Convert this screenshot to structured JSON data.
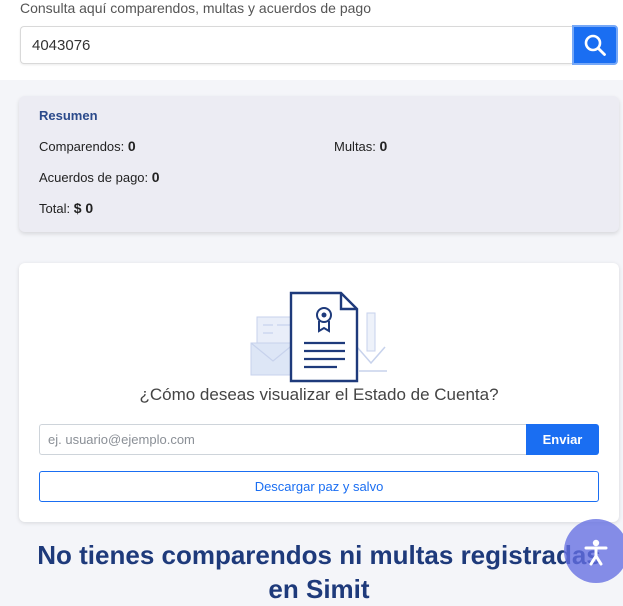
{
  "search": {
    "caption": "Consulta aquí comparendos, multas y acuerdos de pago",
    "value": "4043076",
    "icon": "search-icon",
    "accent": "#1a6ef2"
  },
  "summary": {
    "title": "Resumen",
    "comparendos_label": "Comparendos:",
    "comparendos_value": "0",
    "multas_label": "Multas:",
    "multas_value": "0",
    "acuerdos_label": "Acuerdos de pago:",
    "acuerdos_value": "0",
    "total_label": "Total:",
    "total_value": "$ 0"
  },
  "statement": {
    "illustration": "certificate-document-icon",
    "question": "¿Cómo deseas visualizar el Estado de Cuenta?",
    "email_placeholder": "ej. usuario@ejemplo.com",
    "send_label": "Enviar",
    "download_label": "Descargar paz y salvo"
  },
  "no_records": {
    "line1": "No tienes comparendos ni multas registradas",
    "line2": "en Simit"
  },
  "fab": {
    "icon": "accessibility-icon"
  },
  "colors": {
    "primary": "#1a6ef2",
    "heading": "#1e3a7b",
    "summary_bg": "#ececf3"
  }
}
